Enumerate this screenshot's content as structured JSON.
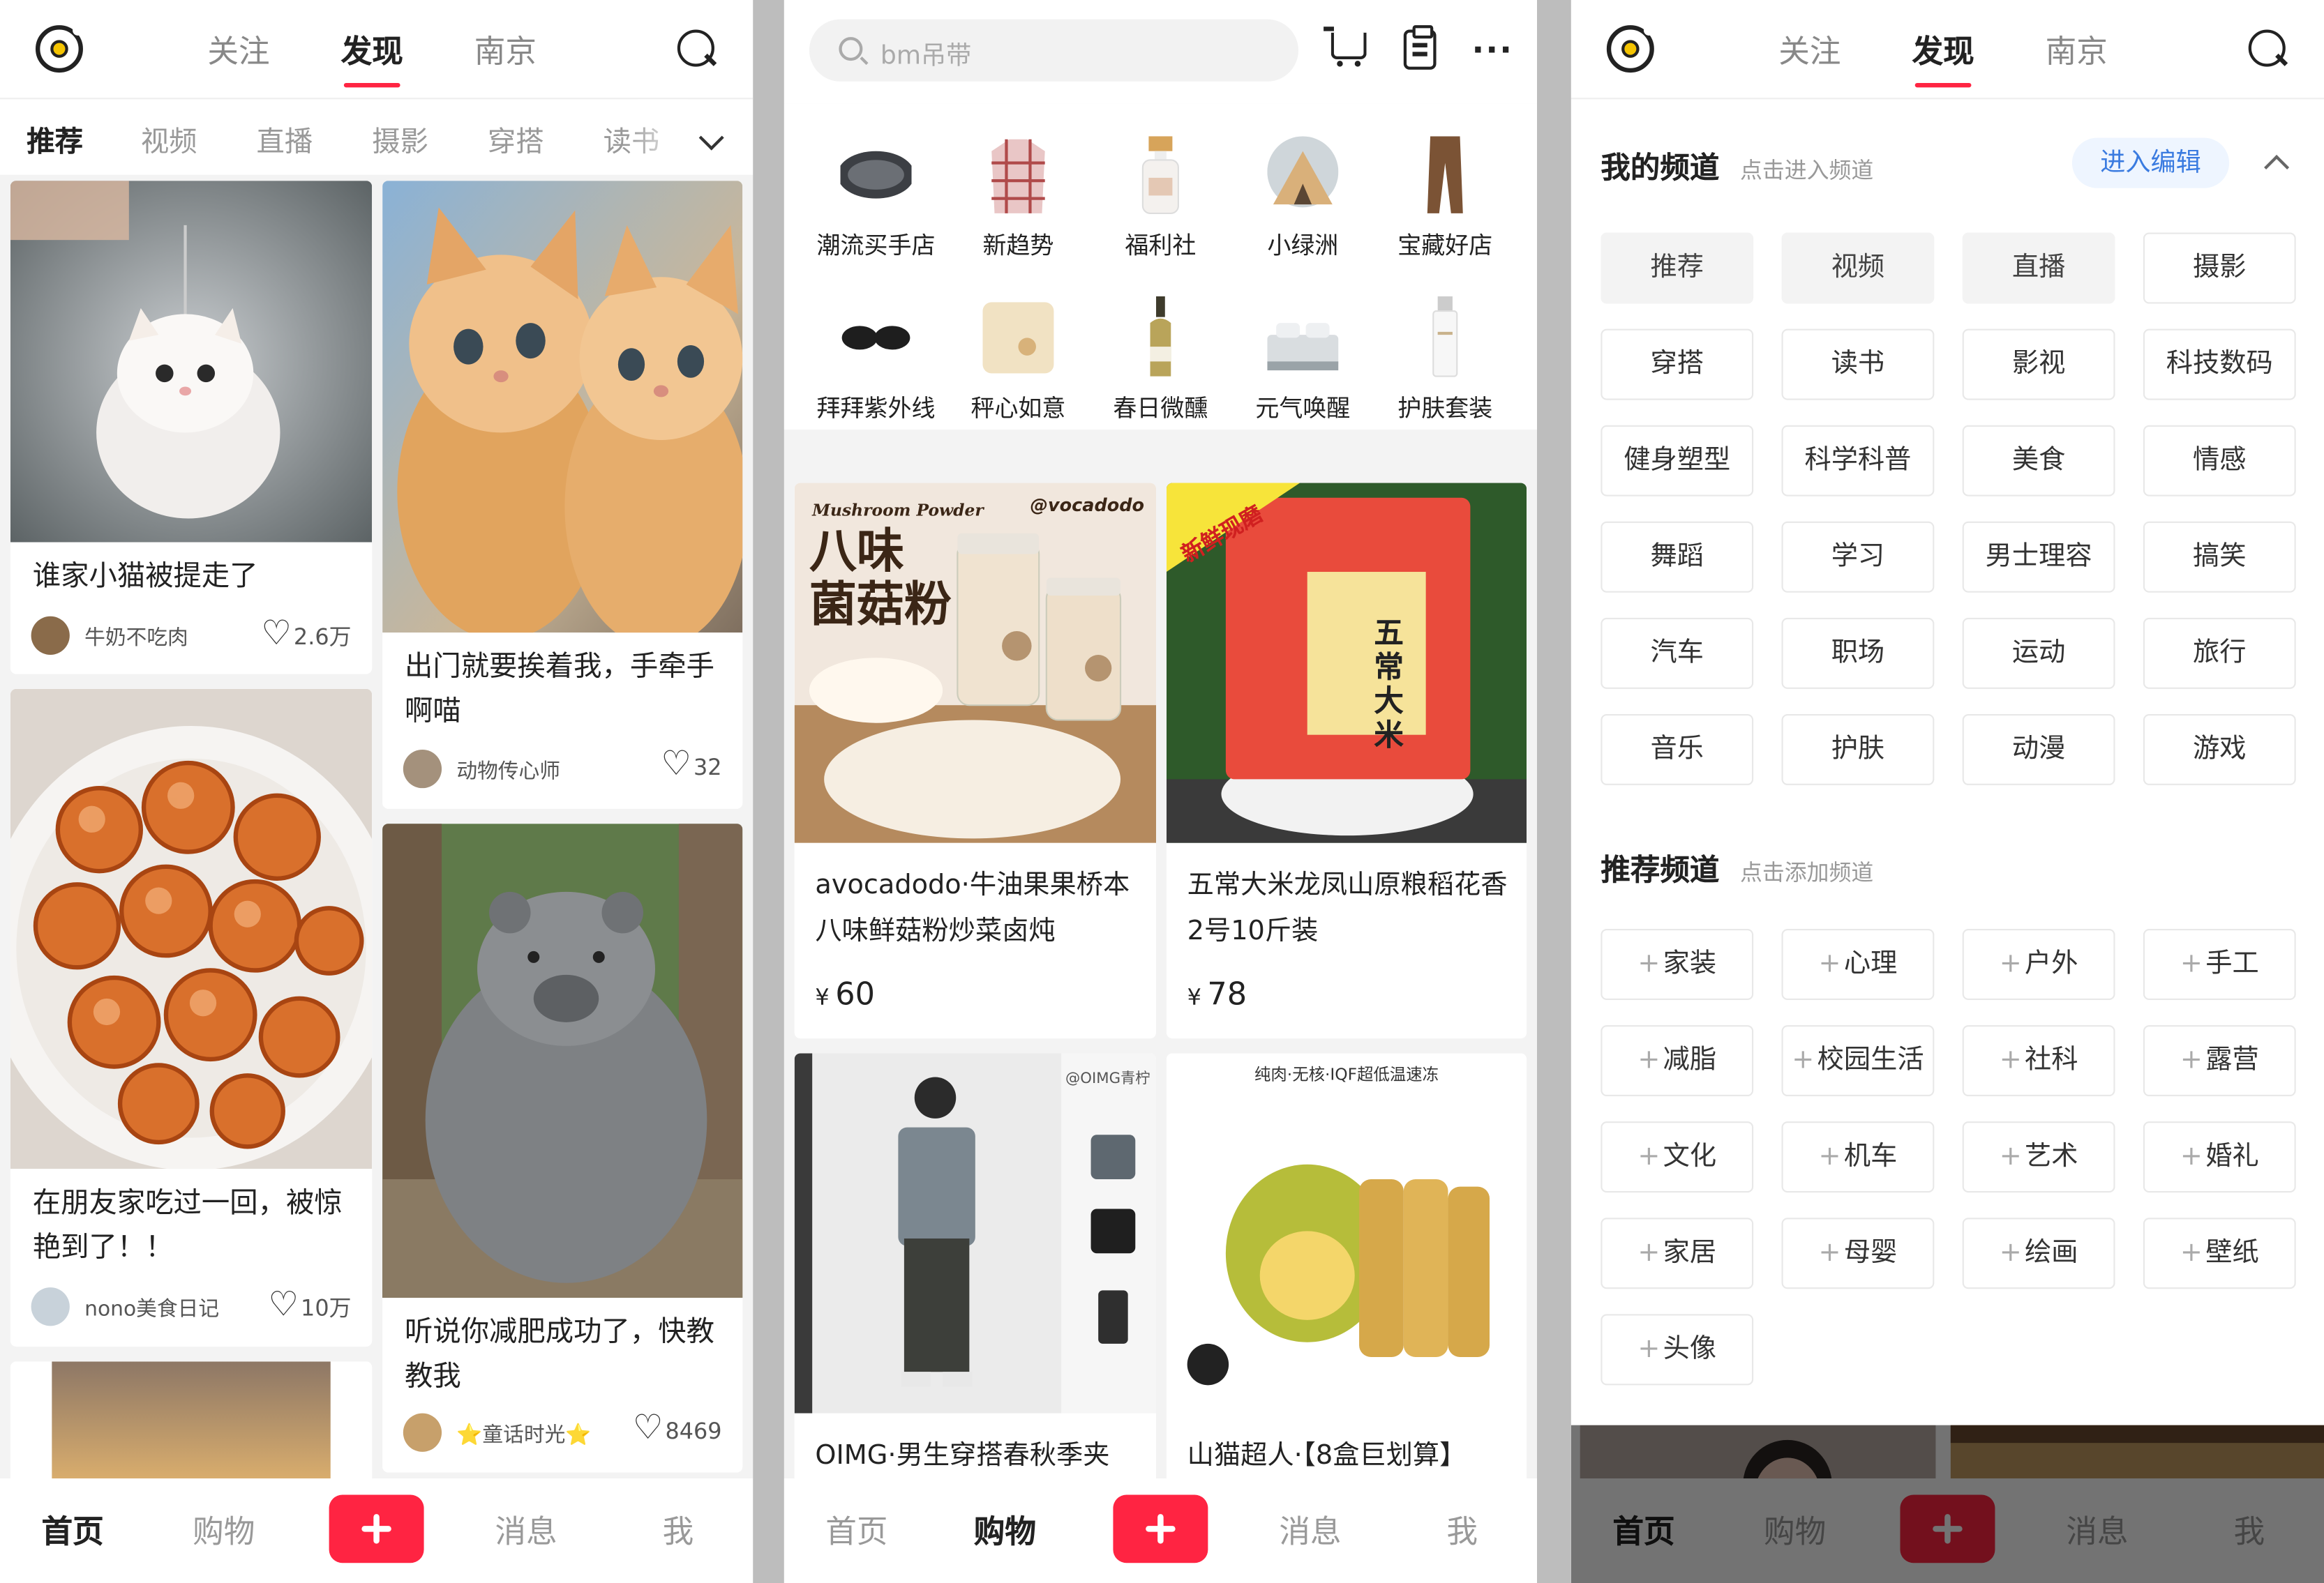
{
  "screens": {
    "feed": {
      "top_tabs": [
        "关注",
        "发现",
        "南京"
      ],
      "active_tab": "发现",
      "channels": [
        "推荐",
        "视频",
        "直播",
        "摄影",
        "穿搭",
        "读书"
      ],
      "active_channel": "推荐",
      "posts": [
        {
          "title": "谁家小猫被提走了",
          "author": "牛奶不吃肉",
          "likes": "2.6万"
        },
        {
          "title": "出门就要挨着我，手牵手啊喵",
          "author": "动物传心师",
          "likes": "32"
        },
        {
          "title": "在朋友家吃过一回，被惊艳到了！！",
          "author": "nono美食日记",
          "likes": "10万"
        },
        {
          "title": "听说你减肥成功了，快教教我",
          "author": "⭐童话时光⭐",
          "likes": "8469"
        }
      ]
    },
    "shop": {
      "search_placeholder": "bm吊带",
      "categories": [
        "潮流买手店",
        "新趋势",
        "福利社",
        "小绿洲",
        "宝藏好店",
        "拜拜紫外线",
        "秤心如意",
        "春日微醺",
        "元气唤醒",
        "护肤套装"
      ],
      "products": [
        {
          "title": "avocadodo·牛油果果桥本八味鲜菇粉炒菜卤炖",
          "price": "60",
          "img_text": "八味\n菌菇粉",
          "brand_text": "@vocadodo",
          "sub_text": "Mushroom Powder"
        },
        {
          "title": "五常大米龙凤山原粮稻花香2号10斤装",
          "price": "78",
          "img_text": "五常大米",
          "banner": "新鲜现磨"
        },
        {
          "title": "OIMG·男生穿搭春秋季夹",
          "price": "",
          "brand_text": "@OIMG青柠"
        },
        {
          "title": "山猫超人·【8盒巨划算】",
          "price": "",
          "img_text": "纯肉·无核·IQF超低温速冻"
        }
      ]
    },
    "channels": {
      "top_tabs": [
        "关注",
        "发现",
        "南京"
      ],
      "my_title": "我的频道",
      "my_hint": "点击进入频道",
      "edit_label": "进入编辑",
      "my_channels": [
        "推荐",
        "视频",
        "直播",
        "摄影",
        "穿搭",
        "读书",
        "影视",
        "科技数码",
        "健身塑型",
        "科学科普",
        "美食",
        "情感",
        "舞蹈",
        "学习",
        "男士理容",
        "搞笑",
        "汽车",
        "职场",
        "运动",
        "旅行",
        "音乐",
        "护肤",
        "动漫",
        "游戏"
      ],
      "fixed_channels": [
        "推荐",
        "视频",
        "直播"
      ],
      "rec_title": "推荐频道",
      "rec_hint": "点击添加频道",
      "rec_channels": [
        "家装",
        "心理",
        "户外",
        "手工",
        "减脂",
        "校园生活",
        "社科",
        "露营",
        "文化",
        "机车",
        "艺术",
        "婚礼",
        "家居",
        "母婴",
        "绘画",
        "壁纸",
        "头像"
      ]
    }
  },
  "nav": {
    "items": [
      "首页",
      "购物",
      "消息",
      "我"
    ],
    "currency": "¥"
  },
  "colors": {
    "accent": "#ff2442",
    "link": "#3a7be0"
  }
}
